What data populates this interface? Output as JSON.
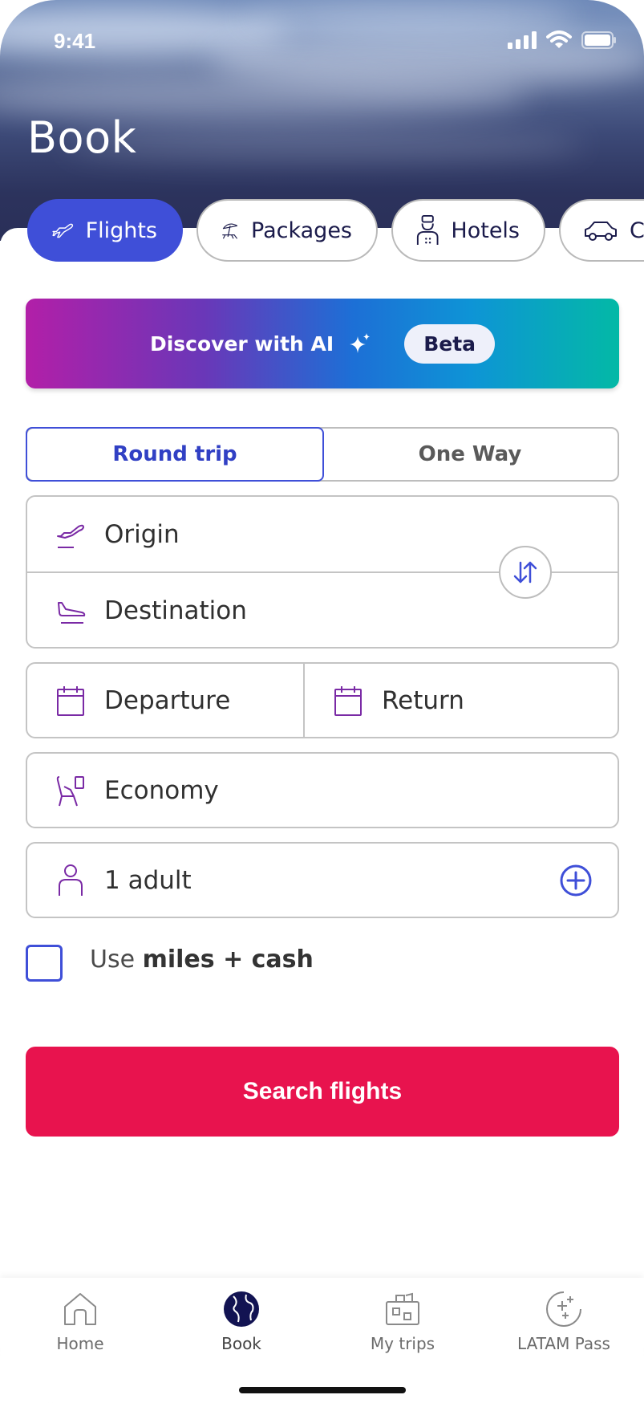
{
  "status_bar": {
    "time": "9:41"
  },
  "header": {
    "title": "Book"
  },
  "tabs": [
    {
      "label": "Flights",
      "icon": "plane-icon",
      "active": true
    },
    {
      "label": "Packages",
      "icon": "beach-umbrella-icon",
      "active": false
    },
    {
      "label": "Hotels",
      "icon": "bellhop-icon",
      "active": false
    },
    {
      "label": "Ca",
      "icon": "car-icon",
      "active": false
    }
  ],
  "ai_banner": {
    "label": "Discover with AI",
    "badge": "Beta",
    "icon": "sparkle-icon"
  },
  "trip_type": {
    "round_trip": "Round trip",
    "one_way": "One Way",
    "selected": "Round trip"
  },
  "form": {
    "origin_placeholder": "Origin",
    "destination_placeholder": "Destination",
    "departure_placeholder": "Departure",
    "return_placeholder": "Return",
    "cabin_value": "Economy",
    "passengers_value": "1 adult"
  },
  "miles": {
    "prefix": "Use ",
    "bold": "miles + cash",
    "checked": false
  },
  "search_button": {
    "label": "Search flights"
  },
  "bottom_nav": [
    {
      "label": "Home",
      "icon": "home-icon",
      "active": false
    },
    {
      "label": "Book",
      "icon": "globe-icon",
      "active": true
    },
    {
      "label": "My trips",
      "icon": "luggage-icon",
      "active": false
    },
    {
      "label": "LATAM Pass",
      "icon": "latam-pass-icon",
      "active": false
    }
  ],
  "colors": {
    "brand_blue": "#3f4fd8",
    "cta": "#e8134e",
    "icon_purple": "#7a2aa5",
    "navy": "#1b1b4b"
  }
}
